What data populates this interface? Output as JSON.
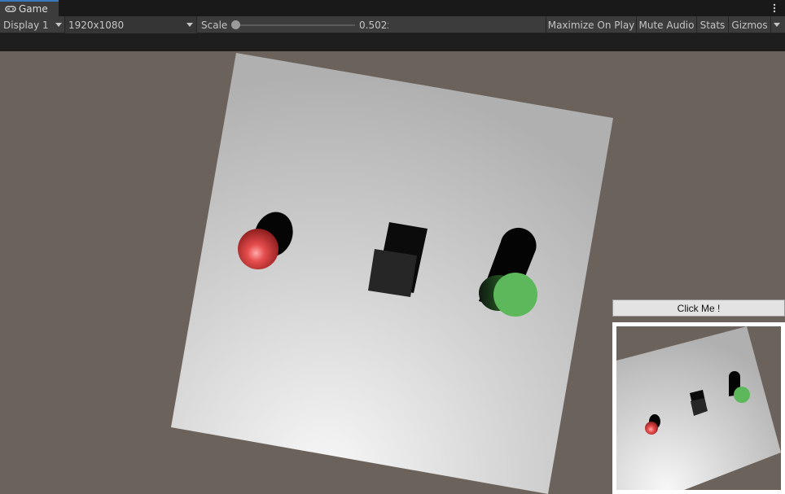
{
  "window": {
    "tab_title": "Game",
    "tab_icon": "gamepad-icon",
    "menu_icon": "kebab-menu-icon"
  },
  "toolbar": {
    "display": "Display 1",
    "resolution": "1920x1080",
    "scale_label": "Scale",
    "scale_value": "0.502x",
    "maximize_on_play": "Maximize On Play",
    "mute_audio": "Mute Audio",
    "stats": "Stats",
    "gizmos": "Gizmos"
  },
  "overlay": {
    "button_label": "Click Me !"
  },
  "colors": {
    "accent": "#3a79bb",
    "background": "#6b625b",
    "plane": "#c9c9c9",
    "sphere": "#d9403f",
    "cylinder": "#5cb85a",
    "cube": "#222222"
  }
}
